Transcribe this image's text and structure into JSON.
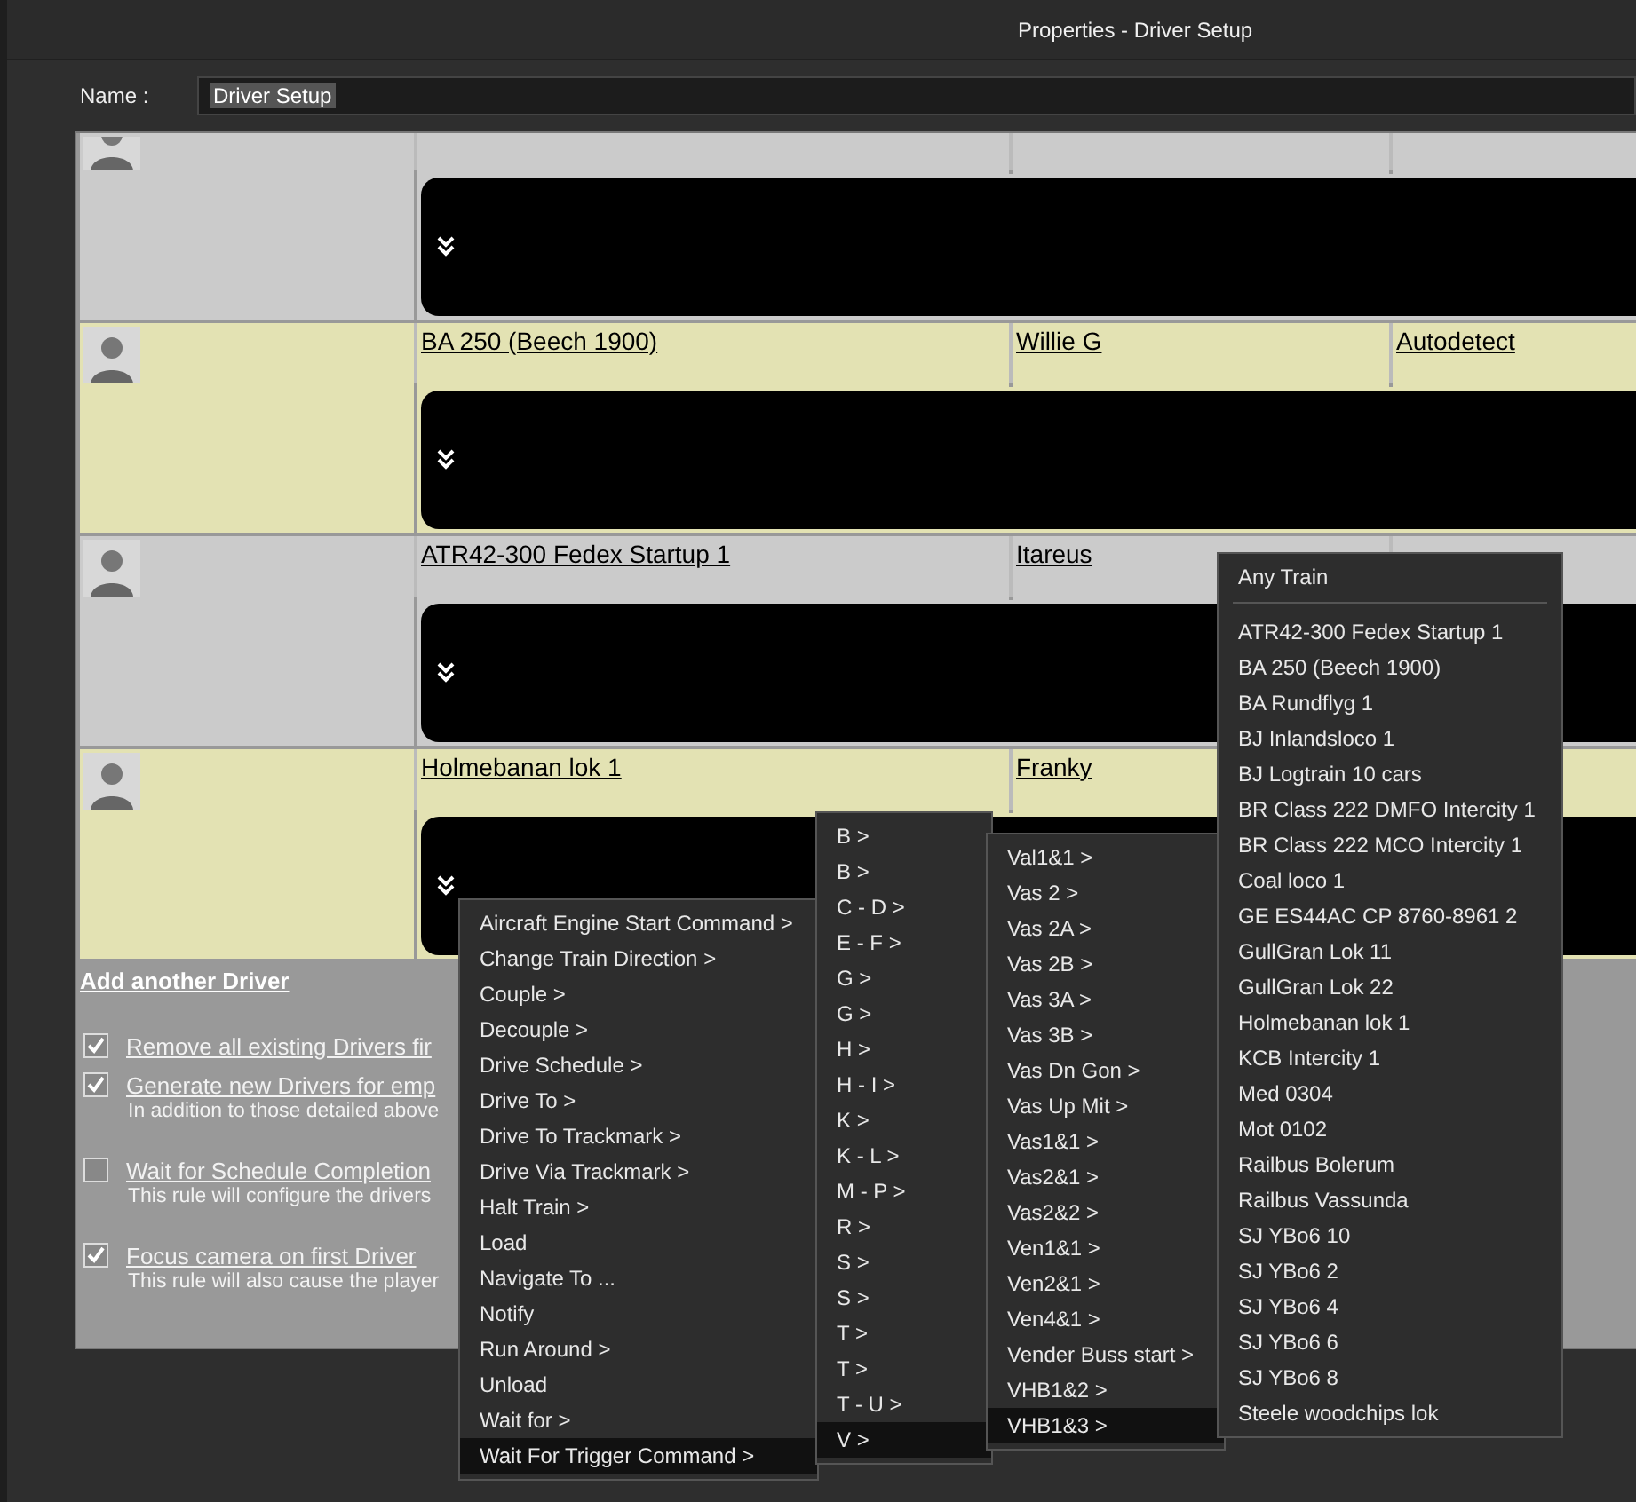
{
  "window": {
    "title": "Properties - Driver Setup"
  },
  "name_field": {
    "label": "Name :",
    "value": "Driver Setup"
  },
  "drivers": [
    {
      "kind": "partial"
    },
    {
      "kind": "full",
      "train": "BA 250 (Beech 1900)",
      "driver": "Willie G",
      "mode": "Autodetect"
    },
    {
      "kind": "full",
      "train": "ATR42-300 Fedex Startup 1",
      "driver": "Itareus"
    },
    {
      "kind": "full",
      "train": "Holmebanan lok 1",
      "driver": "Franky"
    }
  ],
  "add_link": "Add another Driver",
  "options": [
    {
      "label": "Remove all existing Drivers fir",
      "checked": true
    },
    {
      "label": "Generate new Drivers for emp",
      "checked": true,
      "description": "In addition to those detailed above"
    },
    {
      "label": "Wait for Schedule Completion",
      "checked": false,
      "description": "This rule will configure the drivers"
    },
    {
      "label": "Focus camera on first Driver",
      "checked": true,
      "description": "This rule will also cause the player"
    }
  ],
  "command_menu": [
    {
      "label": "Aircraft Engine Start Command >",
      "selected": false
    },
    {
      "label": "Change Train Direction >",
      "selected": false
    },
    {
      "label": "Couple >",
      "selected": false
    },
    {
      "label": "Decouple >",
      "selected": false
    },
    {
      "label": "Drive Schedule >",
      "selected": false
    },
    {
      "label": "Drive To >",
      "selected": false
    },
    {
      "label": "Drive To Trackmark >",
      "selected": false
    },
    {
      "label": "Drive Via Trackmark >",
      "selected": false
    },
    {
      "label": "Halt Train >",
      "selected": false
    },
    {
      "label": "Load",
      "selected": false
    },
    {
      "label": "Navigate To ...",
      "selected": false
    },
    {
      "label": "Notify",
      "selected": false
    },
    {
      "label": "Run Around >",
      "selected": false
    },
    {
      "label": "Unload",
      "selected": false
    },
    {
      "label": "Wait for >",
      "selected": false
    },
    {
      "label": "Wait For Trigger Command >",
      "selected": true
    }
  ],
  "letter_menu": [
    {
      "label": "B >",
      "selected": false
    },
    {
      "label": "B >",
      "selected": false
    },
    {
      "label": "C - D >",
      "selected": false
    },
    {
      "label": "E - F >",
      "selected": false
    },
    {
      "label": "G >",
      "selected": false
    },
    {
      "label": "G >",
      "selected": false
    },
    {
      "label": "H >",
      "selected": false
    },
    {
      "label": "H - I >",
      "selected": false
    },
    {
      "label": "K >",
      "selected": false
    },
    {
      "label": "K - L >",
      "selected": false
    },
    {
      "label": "M - P >",
      "selected": false
    },
    {
      "label": "R >",
      "selected": false
    },
    {
      "label": "S >",
      "selected": false
    },
    {
      "label": "S >",
      "selected": false
    },
    {
      "label": "T >",
      "selected": false
    },
    {
      "label": "T >",
      "selected": false
    },
    {
      "label": "T - U >",
      "selected": false
    },
    {
      "label": "V >",
      "selected": true
    }
  ],
  "trigger_menu": [
    {
      "label": "Val1&1 >",
      "selected": false
    },
    {
      "label": "Vas 2 >",
      "selected": false
    },
    {
      "label": "Vas 2A >",
      "selected": false
    },
    {
      "label": "Vas 2B >",
      "selected": false
    },
    {
      "label": "Vas 3A >",
      "selected": false
    },
    {
      "label": "Vas 3B >",
      "selected": false
    },
    {
      "label": "Vas Dn Gon >",
      "selected": false
    },
    {
      "label": "Vas Up Mit >",
      "selected": false
    },
    {
      "label": "Vas1&1 >",
      "selected": false
    },
    {
      "label": "Vas2&1 >",
      "selected": false
    },
    {
      "label": "Vas2&2 >",
      "selected": false
    },
    {
      "label": "Ven1&1 >",
      "selected": false
    },
    {
      "label": "Ven2&1 >",
      "selected": false
    },
    {
      "label": "Ven4&1 >",
      "selected": false
    },
    {
      "label": "Vender Buss start >",
      "selected": false
    },
    {
      "label": "VHB1&2 >",
      "selected": false
    },
    {
      "label": "VHB1&3 >",
      "selected": true
    }
  ],
  "train_menu": {
    "header": "Any Train",
    "items": [
      "ATR42-300 Fedex Startup 1",
      "BA 250 (Beech 1900)",
      "BA Rundflyg 1",
      "BJ Inlandsloco 1",
      "BJ Logtrain 10 cars",
      "BR Class 222 DMFO Intercity 1",
      "BR Class 222 MCO Intercity 1",
      "Coal loco 1",
      "GE ES44AC CP 8760-8961 2",
      "GullGran Lok 11",
      "GullGran Lok 22",
      "Holmebanan lok 1",
      "KCB Intercity 1",
      "Med 0304",
      "Mot 0102",
      "Railbus Bolerum",
      "Railbus Vassunda",
      "SJ YBo6 10",
      "SJ YBo6 2",
      "SJ YBo6 4",
      "SJ YBo6 6",
      "SJ YBo6 8",
      "Steele woodchips lok"
    ]
  }
}
